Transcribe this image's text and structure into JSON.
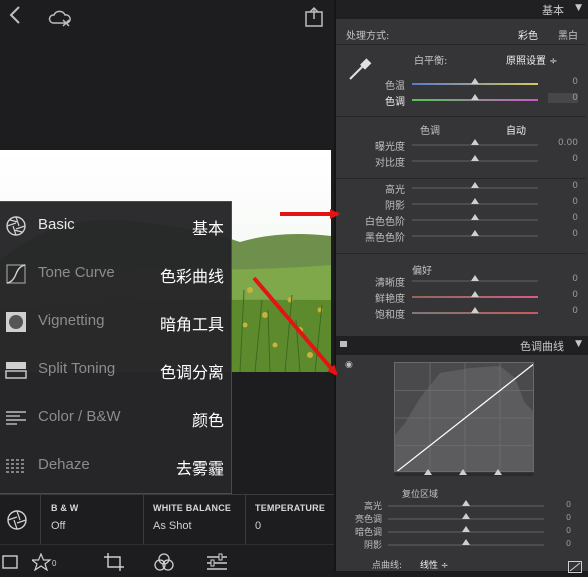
{
  "mobile": {
    "menu": [
      {
        "label": "Basic",
        "cn": "基本",
        "icon": "aperture-icon",
        "active": true
      },
      {
        "label": "Tone Curve",
        "cn": "色彩曲线",
        "icon": "tone-curve-icon"
      },
      {
        "label": "Vignetting",
        "cn": "暗角工具",
        "icon": "vignette-icon"
      },
      {
        "label": "Split Toning",
        "cn": "色调分离",
        "icon": "split-toning-icon"
      },
      {
        "label": "Color / B&W",
        "cn": "颜色",
        "icon": "color-bw-icon"
      },
      {
        "label": "Dehaze",
        "cn": "去雾霾",
        "icon": "dehaze-icon"
      }
    ],
    "bottom": [
      {
        "head": "B & W",
        "value": "Off"
      },
      {
        "head": "WHITE BALANCE",
        "value": "As Shot"
      },
      {
        "head": "TEMPERATURE",
        "value": "0"
      }
    ],
    "toolbar_rating_count": "0"
  },
  "panel": {
    "header_basic": "基本",
    "treatment_label": "处理方式:",
    "treatment_color": "彩色",
    "treatment_bw": "黑白",
    "wb_label": "白平衡:",
    "wb_value": "原照设置 ÷",
    "tone_label": "色调",
    "tone_auto": "自动",
    "presence_label": "偏好",
    "header_tone_curve": "色调曲线",
    "region_label": "复位区域",
    "point_curve_label": "点曲线:",
    "point_curve_value": "线性 ÷",
    "sliders": [
      {
        "label": "色温",
        "value": "0",
        "thumb": 0.5
      },
      {
        "label": "色调",
        "value": "0",
        "thumb": 0.5
      },
      {
        "label": "曝光度",
        "value": "0.00",
        "thumb": 0.5
      },
      {
        "label": "对比度",
        "value": "0",
        "thumb": 0.5
      },
      {
        "label": "高光",
        "value": "0",
        "thumb": 0.5
      },
      {
        "label": "阴影",
        "value": "0",
        "thumb": 0.5
      },
      {
        "label": "白色色阶",
        "value": "0",
        "thumb": 0.5
      },
      {
        "label": "黑色色阶",
        "value": "0",
        "thumb": 0.5
      },
      {
        "label": "清晰度",
        "value": "0",
        "thumb": 0.5
      },
      {
        "label": "鲜艳度",
        "value": "0",
        "thumb": 0.5
      },
      {
        "label": "饱和度",
        "value": "0",
        "thumb": 0.5
      }
    ],
    "region_sliders": [
      {
        "label": "高光",
        "value": "0",
        "thumb": 0.5
      },
      {
        "label": "亮色调",
        "value": "0",
        "thumb": 0.5
      },
      {
        "label": "暗色调",
        "value": "0",
        "thumb": 0.5
      },
      {
        "label": "阴影",
        "value": "0",
        "thumb": 0.5
      }
    ]
  },
  "colors": {
    "annotation_arrow": "#e31414",
    "panel_bg": "#353537",
    "app_bg": "#1d1d1f"
  }
}
